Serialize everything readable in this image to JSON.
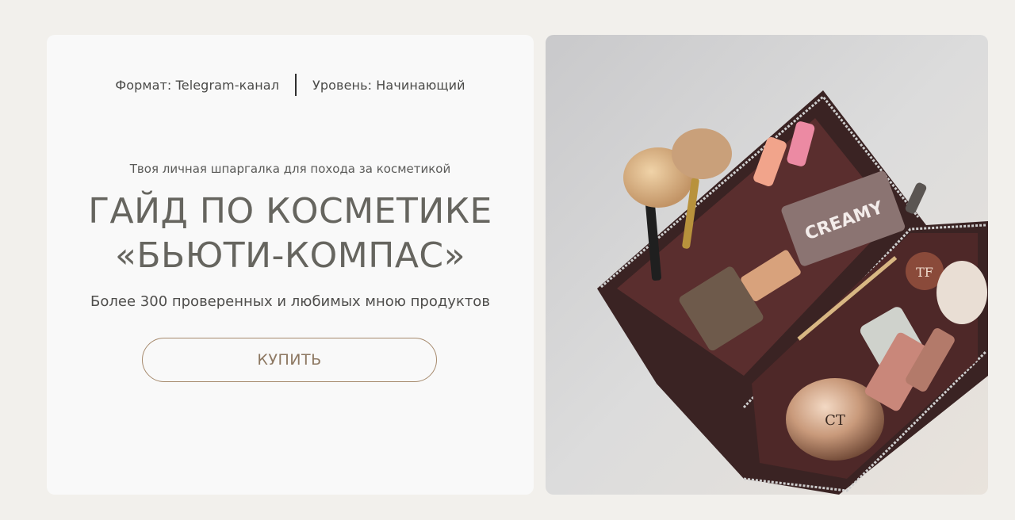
{
  "meta": {
    "format": "Формат: Telegram-канал",
    "level": "Уровень: Начинающий"
  },
  "hero": {
    "subtitle": "Твоя личная шпаргалка для похода за косметикой",
    "title_line1": "ГАЙД ПО КОСМЕТИКЕ",
    "title_line2": "«БЬЮТИ-КОМПАС»",
    "description": "Более 300 проверенных и любимых мною продуктов",
    "buy_label": "КУПИТЬ"
  },
  "photo": {
    "palette_label": "CREAMY",
    "compact_label": "CT",
    "jar_label": "TF"
  },
  "colors": {
    "page_bg": "#f2f0ec",
    "card_bg": "#f9f9f9",
    "title": "#66655f",
    "button_border": "#a68a6d",
    "button_text": "#8d7862",
    "bag_leather": "#3a2323",
    "bag_lining": "#5a2e2e"
  }
}
